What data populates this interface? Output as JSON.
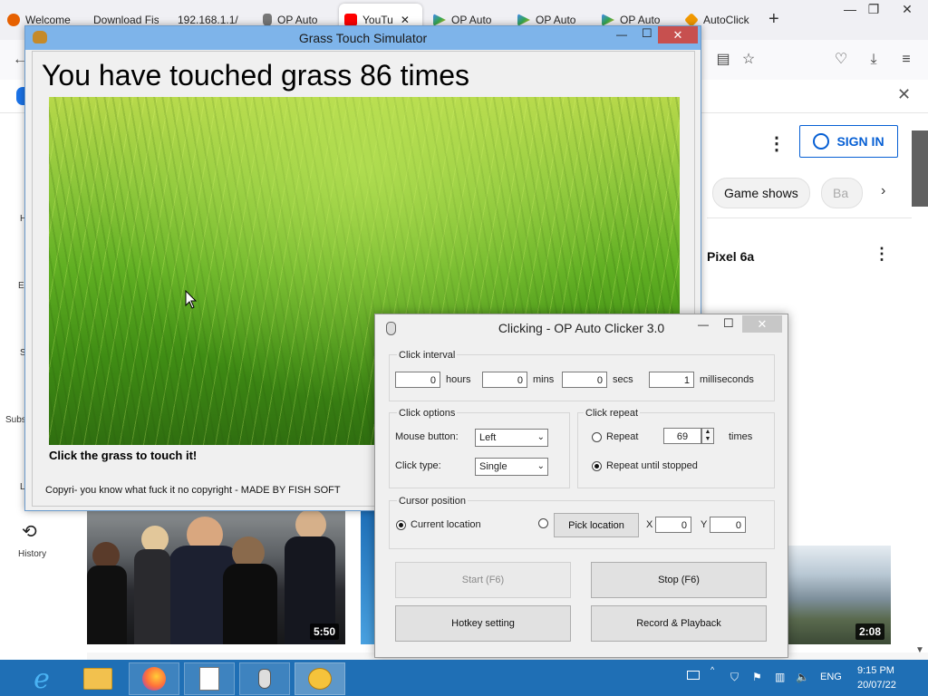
{
  "browser": {
    "tabs": [
      {
        "label": "Welcome",
        "color": "#e66000"
      },
      {
        "label": "Download Fis",
        "color": "#888888"
      },
      {
        "label": "192.168.1.1/",
        "color": "#888888"
      },
      {
        "label": "OP Auto",
        "color": "#666666"
      },
      {
        "label": "YouTu",
        "color": "#ff0000",
        "active": true
      },
      {
        "label": "OP Auto",
        "color": "#34a853"
      },
      {
        "label": "OP Auto",
        "color": "#34a853"
      },
      {
        "label": "OP Auto",
        "color": "#34a853"
      },
      {
        "label": "AutoClick",
        "color": "#f29900"
      }
    ],
    "new_tab": "+",
    "minimize": "—",
    "restore": "❐",
    "close": "✕",
    "close_findbar": "✕"
  },
  "youtube": {
    "sign_in": "SIGN IN",
    "chips": [
      "Game shows",
      "Ba"
    ],
    "video_title_partial": "Pixel 6a",
    "sidebar": {
      "history": "History",
      "subs": "Subs",
      "letters": [
        "H",
        "E",
        "S",
        "L"
      ]
    },
    "durations": [
      "5:50",
      "2:08"
    ]
  },
  "grass_window": {
    "title": "Grass Touch Simulator",
    "counter_text": "You have touched grass 86 times",
    "caption": "Click the grass to touch it!",
    "copyright": "Copyri- you know what fuck it no copyright - MADE BY FISH SOFT",
    "minimize": "—",
    "maximize": "☐",
    "close": "✕"
  },
  "clicker": {
    "title": "Clicking - OP Auto Clicker 3.0",
    "minimize": "—",
    "maximize": "☐",
    "close": "✕",
    "click_interval": {
      "legend": "Click interval",
      "hours": "0",
      "hours_label": "hours",
      "mins": "0",
      "mins_label": "mins",
      "secs": "0",
      "secs_label": "secs",
      "ms": "1",
      "ms_label": "milliseconds"
    },
    "click_options": {
      "legend": "Click options",
      "mouse_button_label": "Mouse button:",
      "mouse_button_value": "Left",
      "click_type_label": "Click type:",
      "click_type_value": "Single"
    },
    "click_repeat": {
      "legend": "Click repeat",
      "repeat_label": "Repeat",
      "repeat_count": "69",
      "times_label": "times",
      "until_stopped_label": "Repeat until stopped",
      "selected": "until_stopped"
    },
    "cursor_position": {
      "legend": "Cursor position",
      "current_location_label": "Current location",
      "pick_location_label": "Pick location",
      "x_label": "X",
      "x_value": "0",
      "y_label": "Y",
      "y_value": "0",
      "selected": "current"
    },
    "buttons": {
      "start": "Start (F6)",
      "stop": "Stop (F6)",
      "hotkey": "Hotkey setting",
      "record": "Record & Playback"
    }
  },
  "taskbar": {
    "language": "ENG",
    "time": "9:15 PM",
    "date": "20/07/22"
  }
}
